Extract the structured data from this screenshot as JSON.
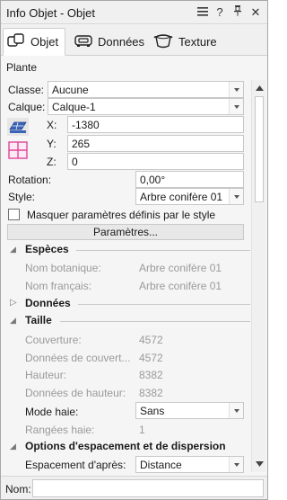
{
  "window": {
    "title": "Info Objet - Objet",
    "menu_icon": "hamburger-icon",
    "help_label": "?",
    "pin_icon": "pin-icon",
    "close_label": "✕"
  },
  "tabs": [
    {
      "label": "Objet",
      "icon": "object-icon",
      "active": true
    },
    {
      "label": "Données",
      "icon": "data-icon",
      "active": false
    },
    {
      "label": "Texture",
      "icon": "texture-icon",
      "active": false
    }
  ],
  "object_type": "Plante",
  "fields": {
    "classe_label": "Classe:",
    "classe_value": "Aucune",
    "calque_label": "Calque:",
    "calque_value": "Calque-1",
    "x_label": "X:",
    "x_value": "-1380",
    "y_label": "Y:",
    "y_value": "265",
    "z_label": "Z:",
    "z_value": "0",
    "rotation_label": "Rotation:",
    "rotation_value": "0,00°",
    "style_label": "Style:",
    "style_value": "Arbre conifère 01"
  },
  "mask_checkbox_label": "Masquer paramètres définis par le style",
  "params_button": "Paramètres...",
  "groups": {
    "especes": {
      "title": "Espèces",
      "rows": [
        {
          "label": "Nom botanique:",
          "value": "Arbre conifère 01"
        },
        {
          "label": "Nom français:",
          "value": "Arbre conifère 01"
        }
      ]
    },
    "donnees": {
      "title": "Données"
    },
    "taille": {
      "title": "Taille",
      "rows": [
        {
          "label": "Couverture:",
          "value": "4572"
        },
        {
          "label": "Données de couvert...",
          "value": "4572"
        },
        {
          "label": "Hauteur:",
          "value": "8382"
        },
        {
          "label": "Données de hauteur:",
          "value": "8382"
        }
      ],
      "haie_label": "Mode haie:",
      "haie_value": "Sans",
      "rangees_label": "Rangées haie:",
      "rangees_value": "1"
    },
    "options": {
      "title": "Options d'espacement et de dispersion",
      "espacement_label": "Espacement d'après:",
      "espacement_value": "Distance"
    }
  },
  "name_label": "Nom:",
  "name_value": "",
  "colors": {
    "accent_blue": "#3b63b8",
    "accent_pink": "#e0479a",
    "muted_text": "#9a9a9a"
  }
}
